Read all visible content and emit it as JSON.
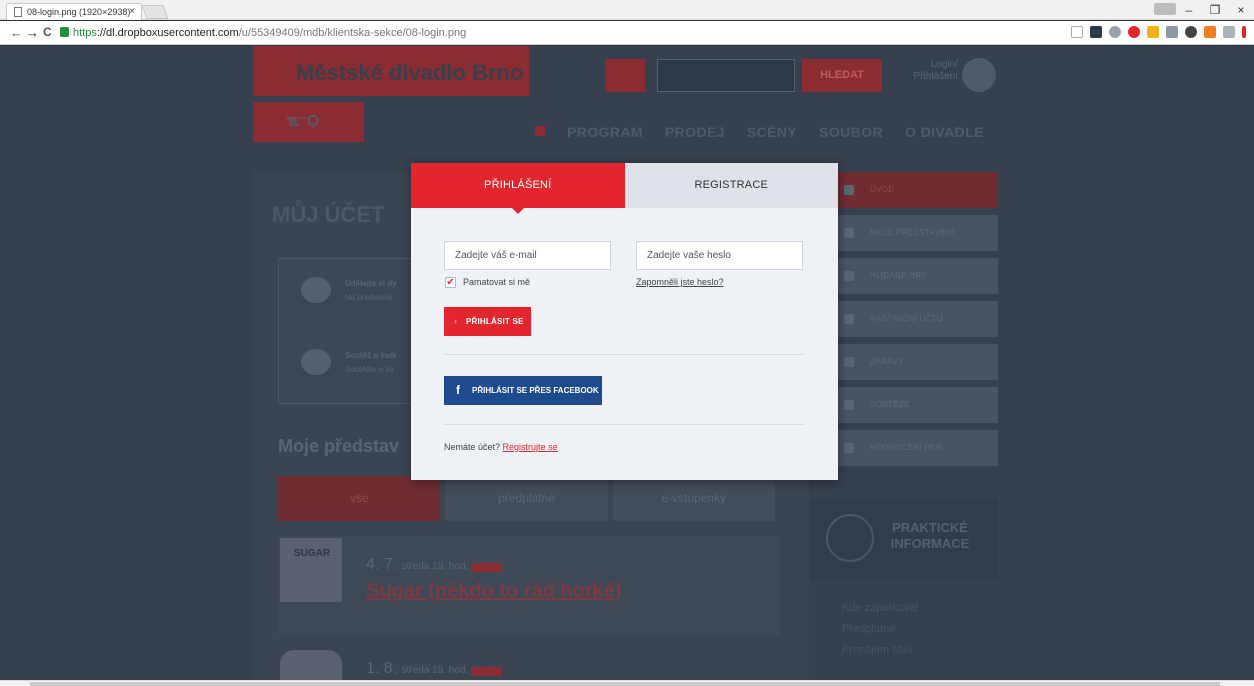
{
  "browser": {
    "tab_title": "08-login.png (1920×2938)",
    "tab_close": "×",
    "url_https": "https",
    "url_domain": "://dl.dropboxusercontent.com",
    "url_path": "/u/55349409/mdb/klientska-sekce/08-login.png",
    "back": "←",
    "forward": "→",
    "reload": "C",
    "minimize": "–",
    "restore": "❐",
    "close": "×"
  },
  "site": {
    "logo": "Městské divadlo Brno",
    "logo2": "ℼ⁻Ọ",
    "search_button": "HLEDAT",
    "login_small": "Login/ Přihlášení",
    "nav": [
      "PROGRAM",
      "PRODEJ",
      "SCÉNY",
      "SOUBOR",
      "O DIVADLE"
    ],
    "page_heading": "MŮJ ÚČET",
    "card1_title": "Udělejte si dy",
    "card1_text": "Na představe",
    "card2_title": "Soutěž o lístk",
    "card2_text": "Soutěžte o lís",
    "my_shows_heading": "Moje představ",
    "show_tabs": [
      "vše",
      "předplatné",
      "e-vstupenky"
    ],
    "show1": {
      "day": "4. 7.",
      "when": "středa 19. hod.",
      "badge": "Činohra",
      "title": "Sugar (někdo to rád horké)"
    },
    "poster1_text": "SUGAR",
    "show2": {
      "day": "1. 8.",
      "when": "středa 19. hod.",
      "badge": "Činohra"
    },
    "sidebar": [
      "ÚVOD",
      "MOJE PŘEDSTAVENÍ",
      "HLÍDANÉ HRY",
      "NASTAVENÍ ÚČTU",
      "ZPRÁVY",
      "SOUTĚŽE",
      "HODNOCENÍ HER"
    ],
    "practical": "PRAKTICKÉ INFORMACE",
    "links": [
      "Kde zaparkovat",
      "Předplatné",
      "Pronájem sálů"
    ]
  },
  "modal": {
    "tab_login": "PŘIHLÁŠENÍ",
    "tab_register": "REGISTRACE",
    "email_placeholder": "Zadejte váš e-mail",
    "password_placeholder": "Zadejte vaše heslo",
    "remember_label": "Pamatovat si mě",
    "remember_checked": true,
    "forgot_link": "Zapomněli jste heslo?",
    "login_button": "PŘIHLÁSIT SE",
    "facebook_button": "PŘIHLÁSIT SE PŘES FACEBOOK",
    "no_account_text": "Nemáte účet?",
    "register_link": "Registrujte se"
  },
  "colors": {
    "accent": "#e3262d",
    "facebook": "#1e4a8e",
    "overlay": "#2b3441"
  }
}
